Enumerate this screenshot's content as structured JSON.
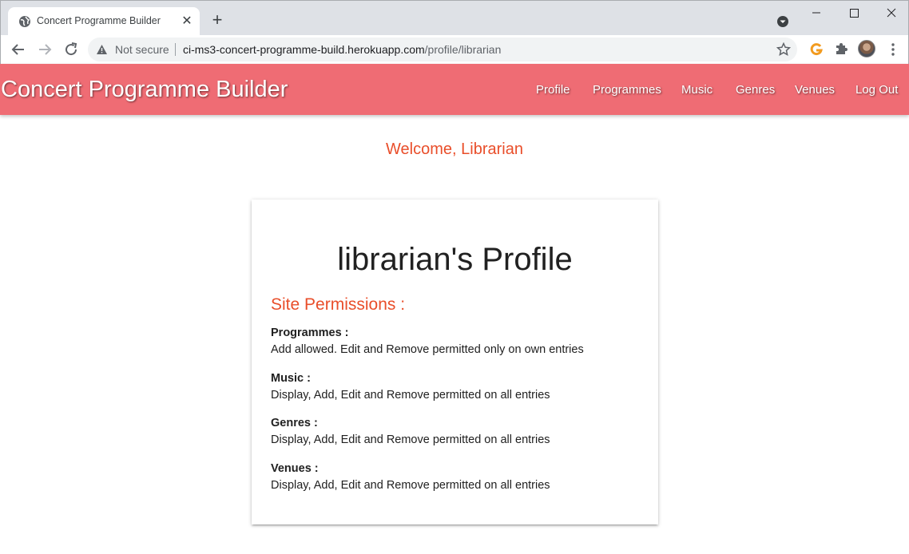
{
  "browser": {
    "tab_title": "Concert Programme Builder",
    "security_label": "Not secure",
    "url_host": "ci-ms3-concert-programme-build.herokuapp.com",
    "url_path": "/profile/librarian"
  },
  "site": {
    "brand": "Concert Programme Builder",
    "nav": [
      "Profile",
      "Programmes",
      "Music",
      "Genres",
      "Venues",
      "Log Out"
    ],
    "nav_color": "#ef6c74",
    "accent_color": "#e94e2a"
  },
  "welcome": "Welcome, Librarian",
  "profile": {
    "title": "librarian's Profile",
    "permissions_heading": "Site Permissions :",
    "permissions": [
      {
        "label": "Programmes :",
        "text": "Add allowed. Edit and Remove permitted only on own entries"
      },
      {
        "label": "Music :",
        "text": "Display, Add, Edit and Remove permitted on all entries"
      },
      {
        "label": "Genres :",
        "text": "Display, Add, Edit and Remove permitted on all entries"
      },
      {
        "label": "Venues :",
        "text": "Display, Add, Edit and Remove permitted on all entries"
      }
    ]
  }
}
